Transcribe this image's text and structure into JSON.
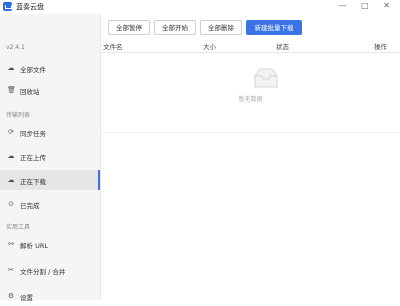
{
  "app": {
    "title": "蓝奏云盘",
    "version": "v2.4.1",
    "window_controls": "— □ ✕"
  },
  "sidebar": {
    "items_top": [
      {
        "label": "全部文件",
        "icon": "cloud-icon"
      },
      {
        "label": "回收站",
        "icon": "trash-icon"
      }
    ],
    "section_transfer": "传输列表",
    "items_transfer": [
      {
        "label": "同步任务",
        "icon": "sync-icon"
      },
      {
        "label": "正在上传",
        "icon": "upload-icon"
      },
      {
        "label": "正在下载",
        "icon": "download-icon"
      },
      {
        "label": "已完成",
        "icon": "check-circle-icon"
      }
    ],
    "section_tools": "实用工具",
    "items_tools": [
      {
        "label": "解析 URL",
        "icon": "link-icon"
      },
      {
        "label": "文件分割 / 合并",
        "icon": "scissors-icon"
      },
      {
        "label": "设置",
        "icon": "gear-icon"
      }
    ]
  },
  "toolbar": {
    "pause_all": "全部暂停",
    "start_all": "全部开始",
    "delete_all": "全部删除",
    "new_batch_download": "新建批量下载"
  },
  "table": {
    "columns": [
      "文件名",
      "大小",
      "状态",
      "操作"
    ],
    "empty_text": "暂无数据"
  },
  "colors": {
    "accent": "#3b73e6",
    "sidebar_bg": "#f5f5f5"
  }
}
